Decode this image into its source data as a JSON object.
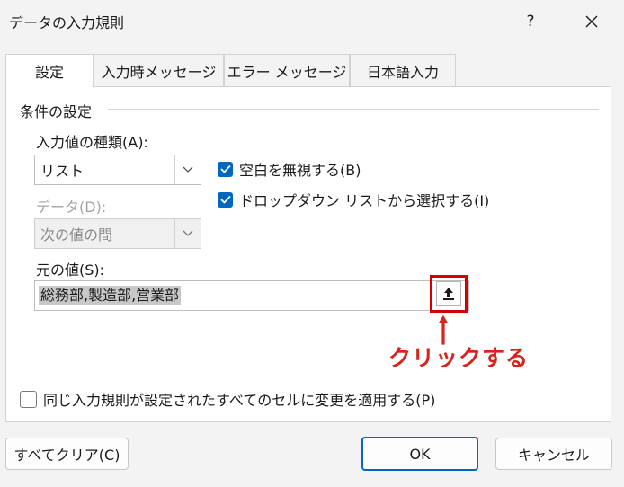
{
  "window": {
    "title": "データの入力規則",
    "help": "?"
  },
  "tabs": [
    {
      "label": "設定",
      "active": true
    },
    {
      "label": "入力時メッセージ",
      "active": false
    },
    {
      "label": "エラー メッセージ",
      "active": false
    },
    {
      "label": "日本語入力",
      "active": false
    }
  ],
  "criteria": {
    "heading": "条件の設定",
    "allow_label": "入力値の種類(A):",
    "allow_value": "リスト",
    "data_label": "データ(D):",
    "data_value": "次の値の間",
    "ignore_blank": {
      "label": "空白を無視する(B)",
      "checked": true
    },
    "in_cell_dropdown": {
      "label": "ドロップダウン リストから選択する(I)",
      "checked": true
    },
    "source_label": "元の値(S):",
    "source_value": "総務部,製造部,営業部"
  },
  "annotation": {
    "text": "クリックする",
    "color": "#d8231c"
  },
  "apply_all": {
    "label": "同じ入力規則が設定されたすべてのセルに変更を適用する(P)",
    "checked": false
  },
  "buttons": {
    "clear_all": "すべてクリア(C)",
    "ok": "OK",
    "cancel": "キャンセル"
  },
  "colors": {
    "accent": "#0067c0",
    "highlight_border": "#d40000"
  }
}
